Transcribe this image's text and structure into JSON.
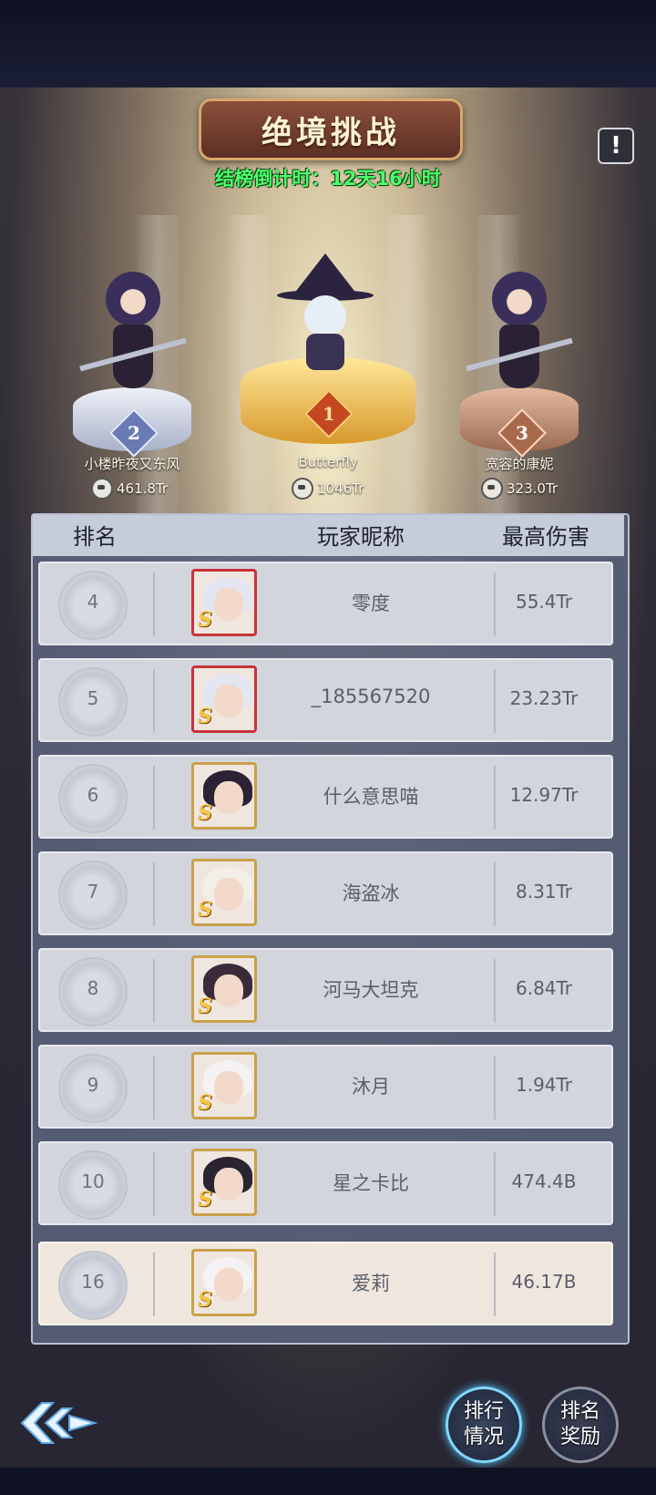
{
  "title": "绝境挑战",
  "countdown": "结榜倒计时：12天16小时",
  "podium": [
    {
      "rank": "2",
      "name": "小楼昨夜又东风",
      "score": "461.8Tr"
    },
    {
      "rank": "1",
      "name": "Butterfly",
      "score": "1046Tr"
    },
    {
      "rank": "3",
      "name": "宽容的康妮",
      "score": "323.0Tr"
    }
  ],
  "table": {
    "headers": {
      "rank": "排名",
      "nickname": "玩家昵称",
      "damage": "最高伤害"
    },
    "rows": [
      {
        "rank": "4",
        "nickname": "零度",
        "damage": "55.4Tr"
      },
      {
        "rank": "5",
        "nickname": "_185567520",
        "damage": "23.23Tr"
      },
      {
        "rank": "6",
        "nickname": "什么意思喵",
        "damage": "12.97Tr"
      },
      {
        "rank": "7",
        "nickname": "海盗冰",
        "damage": "8.31Tr"
      },
      {
        "rank": "8",
        "nickname": "河马大坦克",
        "damage": "6.84Tr"
      },
      {
        "rank": "9",
        "nickname": "沐月",
        "damage": "1.94Tr"
      },
      {
        "rank": "10",
        "nickname": "星之卡比",
        "damage": "474.4B"
      }
    ],
    "my_row": {
      "rank": "16",
      "nickname": "爱莉",
      "damage": "46.17B"
    }
  },
  "avatar_badge": "S",
  "info_icon": "!",
  "buttons": {
    "ranking_status": {
      "line1": "排行",
      "line2": "情况"
    },
    "ranking_reward": {
      "line1": "排名",
      "line2": "奖励"
    }
  },
  "colors": {
    "countdown": "#4dff6a",
    "gold": "#e7b14a",
    "silver": "#c5cbe0",
    "bronze": "#c99275"
  }
}
